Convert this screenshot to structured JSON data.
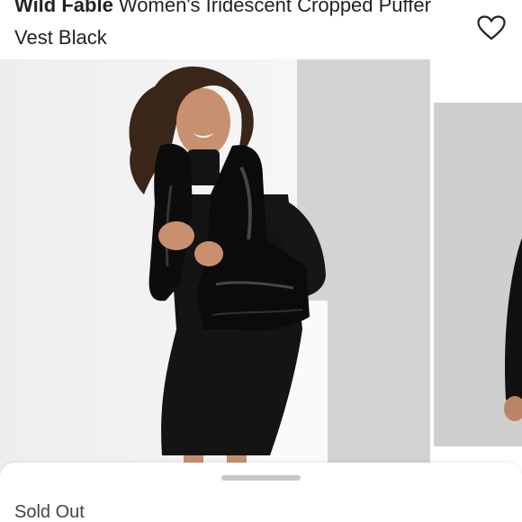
{
  "product": {
    "brand": "Wild Fable",
    "title_rest": " Women's Iridescent Cropped Puffer Vest Black",
    "status": "Sold Out"
  },
  "icons": {
    "favorite": "heart-outline-icon"
  },
  "colors": {
    "background": "#ffffff",
    "text": "#222222",
    "photo_wall": "#d3d3d3",
    "handle": "#c8c8c8"
  }
}
